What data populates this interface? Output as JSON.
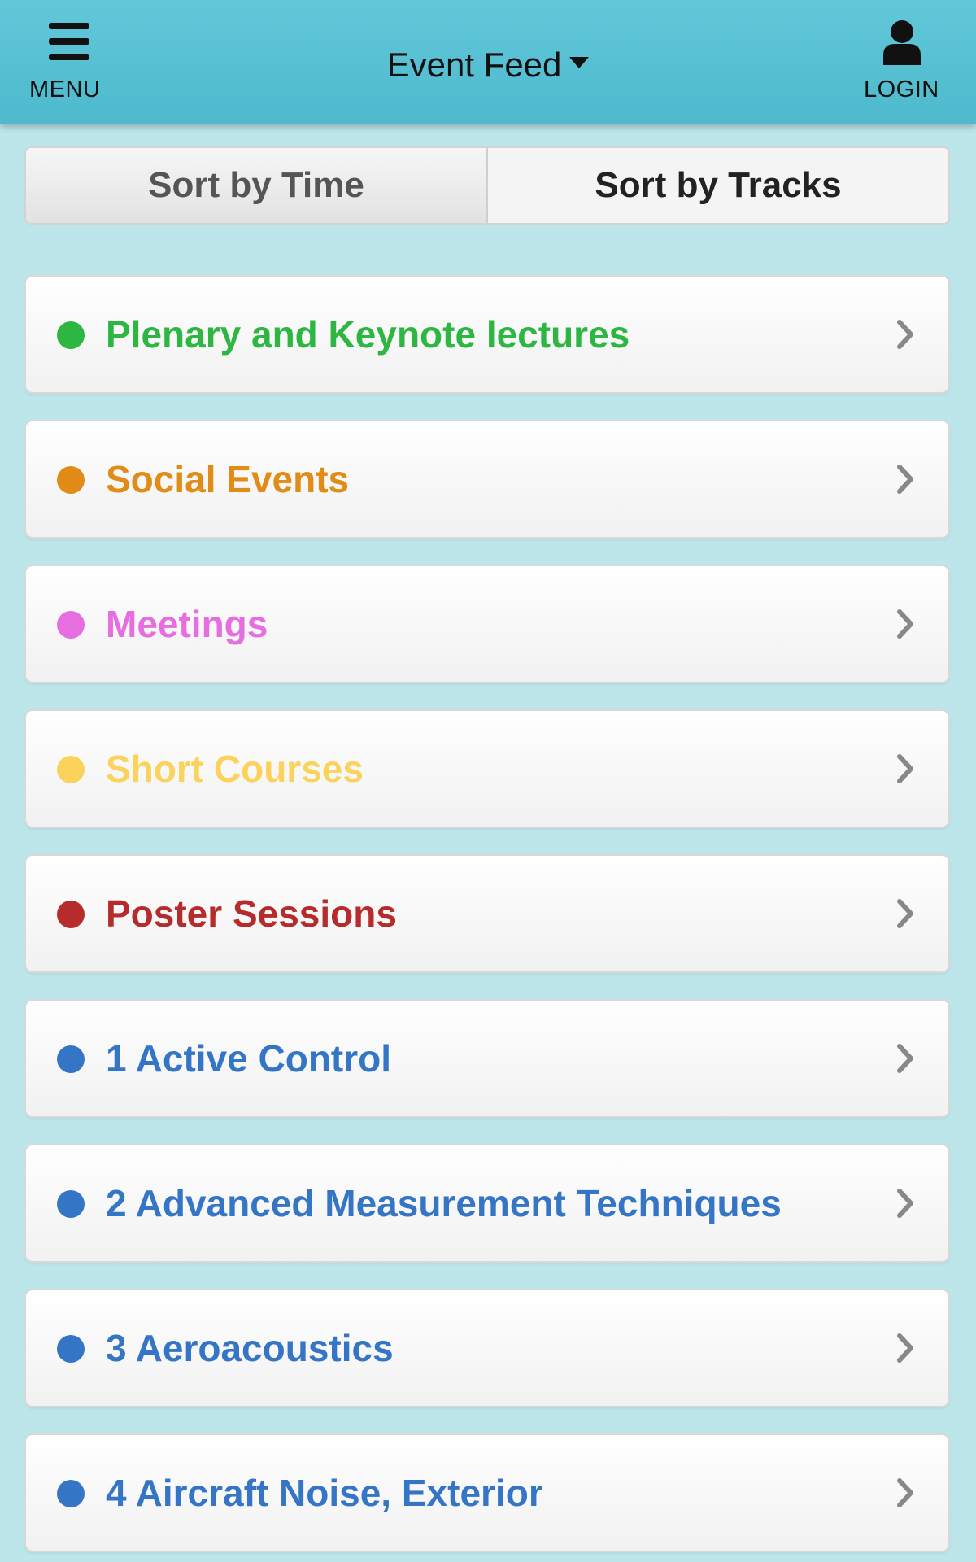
{
  "header": {
    "menu_label": "MENU",
    "title": "Event Feed",
    "login_label": "LOGIN"
  },
  "sort": {
    "time_label": "Sort by Time",
    "tracks_label": "Sort by Tracks",
    "selected": "Sort by Tracks"
  },
  "tracks": [
    {
      "label": "Plenary and Keynote lectures",
      "color": "#2db742"
    },
    {
      "label": "Social Events",
      "color": "#e08c16"
    },
    {
      "label": "Meetings",
      "color": "#e66ee0"
    },
    {
      "label": "Short Courses",
      "color": "#fbd25b"
    },
    {
      "label": "Poster Sessions",
      "color": "#b62c2c"
    },
    {
      "label": "1 Active Control",
      "color": "#3575c5"
    },
    {
      "label": "2 Advanced Measurement Techniques",
      "color": "#3575c5"
    },
    {
      "label": "3 Aeroacoustics",
      "color": "#3575c5"
    },
    {
      "label": "4 Aircraft Noise, Exterior",
      "color": "#3575c5"
    }
  ],
  "icons": {
    "menu": "hamburger-icon",
    "title_dropdown": "caret-down-icon",
    "login": "user-icon",
    "track_dot": "track-color-dot",
    "track_arrow": "chevron-right-icon"
  }
}
